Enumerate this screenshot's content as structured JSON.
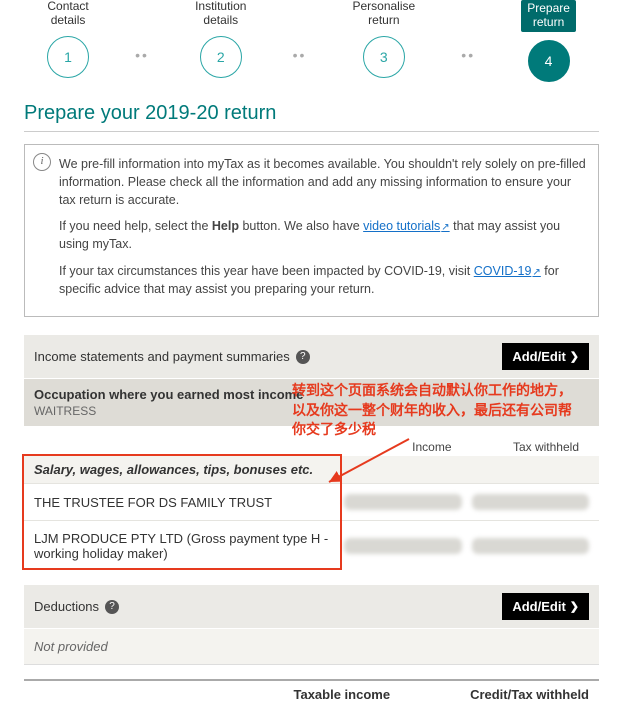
{
  "stepper": {
    "steps": [
      {
        "label_line1": "Contact",
        "label_line2": "details",
        "num": "1"
      },
      {
        "label_line1": "Institution",
        "label_line2": "details",
        "num": "2"
      },
      {
        "label_line1": "Personalise",
        "label_line2": "return",
        "num": "3"
      },
      {
        "label_line1": "Prepare",
        "label_line2": "return",
        "num": "4"
      }
    ]
  },
  "page_title": "Prepare your 2019-20 return",
  "info": {
    "p1": "We pre-fill information into myTax as it becomes available. You shouldn't rely solely on pre-filled information. Please check all the information and add any missing information to ensure your tax return is accurate.",
    "p2a": "If you need help, select the ",
    "p2b_bold": "Help",
    "p2c": " button. We also have ",
    "p2_link": "video tutorials",
    "p2d": " that may assist you using myTax.",
    "p3a": "If your tax circumstances this year have been impacted by COVID-19, visit ",
    "p3_link": "COVID-19",
    "p3b": " for specific advice that may assist you preparing your return."
  },
  "sections": {
    "income_label": "Income statements and payment summaries",
    "add_edit": "Add/Edit",
    "occupation_label": "Occupation where you earned most income",
    "occupation_value": "WAITRESS",
    "income_col": "Income",
    "tax_col": "Tax withheld",
    "salary_header": "Salary, wages, allowances, tips, bonuses etc.",
    "salary_rows": [
      "THE TRUSTEE FOR DS FAMILY TRUST",
      "LJM PRODUCE PTY LTD (Gross payment type H - working holiday maker)"
    ],
    "deductions_label": "Deductions",
    "deductions_value": "Not provided"
  },
  "footer": {
    "taxable_income": "Taxable income",
    "credit_tax": "Credit/Tax withheld"
  },
  "annotation": {
    "line1": "转到这个页面系统会自动默认你工作的地方，",
    "line2": "以及你这一整个财年的收入，最后还有公司帮",
    "line3": "你交了多少税"
  }
}
